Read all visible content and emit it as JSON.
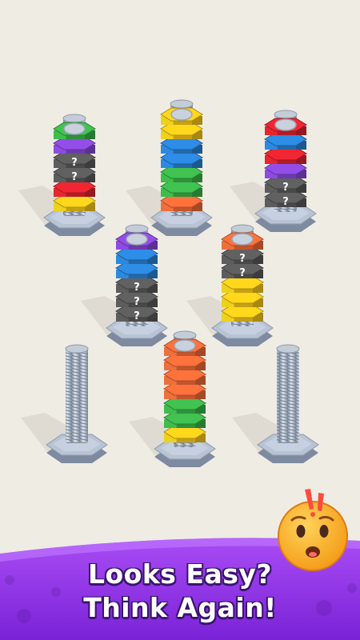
{
  "colors": {
    "green": "#3bb54a",
    "purple": "#8848d8",
    "gray": "#5a5a5a",
    "red": "#e0232e",
    "yellow": "#f6c81a",
    "blue": "#2a83d6",
    "orange": "#f26a38",
    "banner_purple": "#9d3ef0",
    "text_white": "#ffffff"
  },
  "hidden_mark": "?",
  "bolts": [
    {
      "id": "bolt-1",
      "nuts": [
        "yellow",
        "red",
        "gray",
        "gray",
        "purple",
        "green"
      ],
      "hidden": [
        false,
        false,
        true,
        true,
        false,
        false
      ]
    },
    {
      "id": "bolt-2",
      "nuts": [
        "orange",
        "green",
        "green",
        "blue",
        "blue",
        "yellow",
        "yellow"
      ],
      "hidden": [
        false,
        false,
        false,
        false,
        false,
        false,
        false
      ]
    },
    {
      "id": "bolt-3",
      "nuts": [
        "gray",
        "gray",
        "purple",
        "red",
        "blue",
        "red"
      ],
      "hidden": [
        true,
        true,
        false,
        false,
        false,
        false
      ]
    },
    {
      "id": "bolt-4",
      "nuts": [
        "gray",
        "gray",
        "gray",
        "blue",
        "blue",
        "purple"
      ],
      "hidden": [
        true,
        true,
        true,
        false,
        false,
        false
      ]
    },
    {
      "id": "bolt-5",
      "nuts": [
        "yellow",
        "yellow",
        "yellow",
        "gray",
        "gray",
        "orange"
      ],
      "hidden": [
        false,
        false,
        false,
        true,
        true,
        false
      ]
    },
    {
      "id": "bolt-6",
      "nuts": [],
      "hidden": []
    },
    {
      "id": "bolt-7",
      "nuts": [
        "yellow",
        "green",
        "green",
        "orange",
        "orange",
        "orange",
        "orange"
      ],
      "hidden": [
        false,
        false,
        false,
        false,
        false,
        false,
        false
      ]
    },
    {
      "id": "bolt-8",
      "nuts": [],
      "hidden": []
    }
  ],
  "banner": {
    "line1": "Looks Easy?",
    "line2": "Think Again!",
    "mascot": "worried-face-icon",
    "alert": "exclamation-icon"
  }
}
